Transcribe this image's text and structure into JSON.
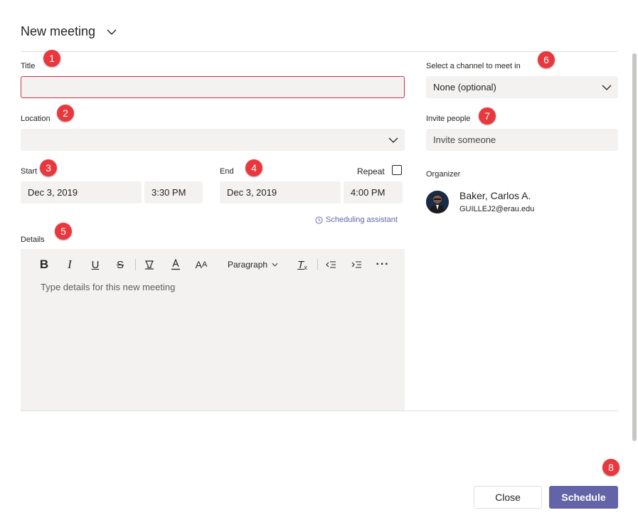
{
  "header": {
    "title": "New meeting"
  },
  "title_field": {
    "label": "Title",
    "value": ""
  },
  "location_field": {
    "label": "Location",
    "value": ""
  },
  "start": {
    "label": "Start",
    "date": "Dec 3, 2019",
    "time": "3:30 PM"
  },
  "end": {
    "label": "End",
    "date": "Dec 3, 2019",
    "time": "4:00 PM"
  },
  "repeat": {
    "label": "Repeat",
    "checked": false
  },
  "scheduling_assistant": {
    "label": "Scheduling assistant"
  },
  "details": {
    "label": "Details",
    "placeholder": "Type details for this new meeting",
    "toolbar": {
      "paragraph_label": "Paragraph"
    }
  },
  "channel": {
    "label": "Select a channel to meet in",
    "value": "None (optional)"
  },
  "invite": {
    "label": "Invite people",
    "placeholder": "Invite someone"
  },
  "organizer": {
    "label": "Organizer",
    "name": "Baker, Carlos A.",
    "email": "GUILLEJ2@erau.edu"
  },
  "footer": {
    "close_label": "Close",
    "schedule_label": "Schedule"
  },
  "badges": [
    "1",
    "2",
    "3",
    "4",
    "5",
    "6",
    "7",
    "8"
  ],
  "colors": {
    "accent": "#6264a7",
    "badge": "#e8383d",
    "error_border": "#c4314b",
    "field_bg": "#f3f2f1"
  }
}
